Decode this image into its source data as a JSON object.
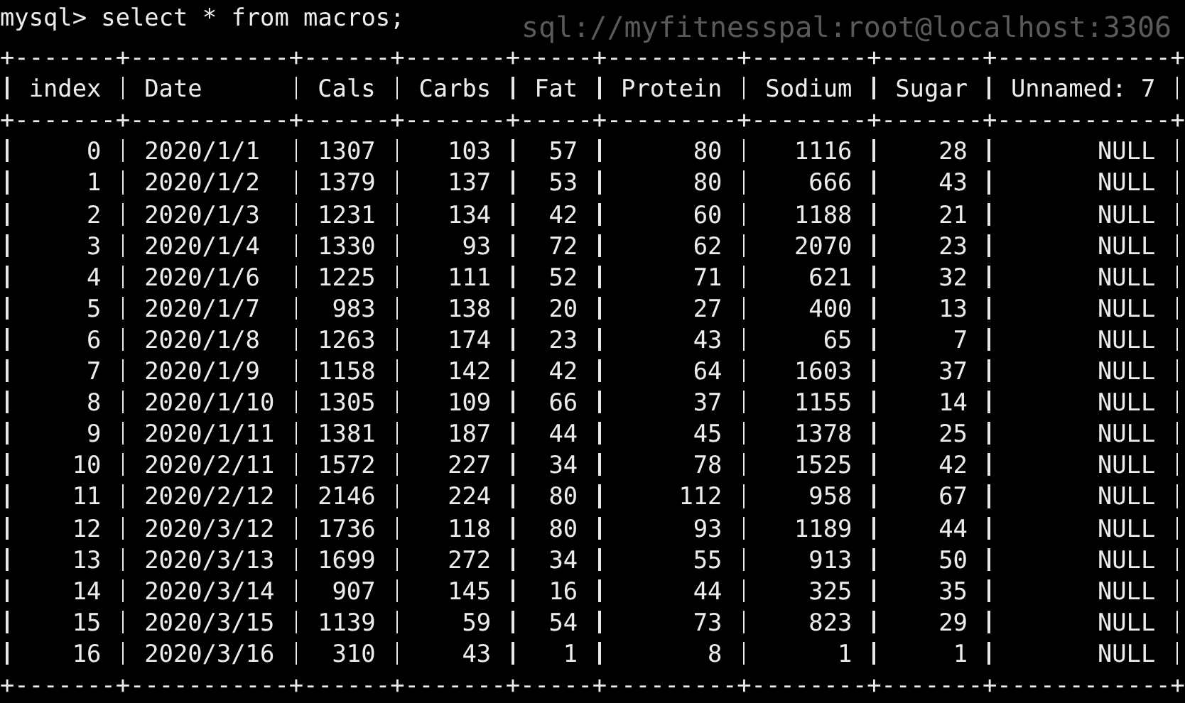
{
  "background_text": "sql://myfitnesspal:root@localhost:3306",
  "prompt": "mysql>",
  "command": "select * from macros;",
  "table": {
    "border_top": "+-------+-----------+------+-------+-----+---------+--------+-------+------------+",
    "columns": [
      "index",
      "Date",
      "Cals",
      "Carbs",
      "Fat",
      "Protein",
      "Sodium",
      "Sugar",
      "Unnamed: 7"
    ],
    "border_header": "+-------+-----------+------+-------+-----+---------+--------+-------+------------+",
    "rows": [
      [
        "0",
        "2020/1/1",
        "1307",
        "103",
        "57",
        "80",
        "1116",
        "28",
        "NULL"
      ],
      [
        "1",
        "2020/1/2",
        "1379",
        "137",
        "53",
        "80",
        "666",
        "43",
        "NULL"
      ],
      [
        "2",
        "2020/1/3",
        "1231",
        "134",
        "42",
        "60",
        "1188",
        "21",
        "NULL"
      ],
      [
        "3",
        "2020/1/4",
        "1330",
        "93",
        "72",
        "62",
        "2070",
        "23",
        "NULL"
      ],
      [
        "4",
        "2020/1/6",
        "1225",
        "111",
        "52",
        "71",
        "621",
        "32",
        "NULL"
      ],
      [
        "5",
        "2020/1/7",
        "983",
        "138",
        "20",
        "27",
        "400",
        "13",
        "NULL"
      ],
      [
        "6",
        "2020/1/8",
        "1263",
        "174",
        "23",
        "43",
        "65",
        "7",
        "NULL"
      ],
      [
        "7",
        "2020/1/9",
        "1158",
        "142",
        "42",
        "64",
        "1603",
        "37",
        "NULL"
      ],
      [
        "8",
        "2020/1/10",
        "1305",
        "109",
        "66",
        "37",
        "1155",
        "14",
        "NULL"
      ],
      [
        "9",
        "2020/1/11",
        "1381",
        "187",
        "44",
        "45",
        "1378",
        "25",
        "NULL"
      ],
      [
        "10",
        "2020/2/11",
        "1572",
        "227",
        "34",
        "78",
        "1525",
        "42",
        "NULL"
      ],
      [
        "11",
        "2020/2/12",
        "2146",
        "224",
        "80",
        "112",
        "958",
        "67",
        "NULL"
      ],
      [
        "12",
        "2020/3/12",
        "1736",
        "118",
        "80",
        "93",
        "1189",
        "44",
        "NULL"
      ],
      [
        "13",
        "2020/3/13",
        "1699",
        "272",
        "34",
        "55",
        "913",
        "50",
        "NULL"
      ],
      [
        "14",
        "2020/3/14",
        "907",
        "145",
        "16",
        "44",
        "325",
        "35",
        "NULL"
      ],
      [
        "15",
        "2020/3/15",
        "1139",
        "59",
        "54",
        "73",
        "823",
        "29",
        "NULL"
      ],
      [
        "16",
        "2020/3/16",
        "310",
        "43",
        "1",
        "8",
        "1",
        "1",
        "NULL"
      ]
    ],
    "border_bottom": "+-------+-----------+------+-------+-----+---------+--------+-------+------------+"
  }
}
